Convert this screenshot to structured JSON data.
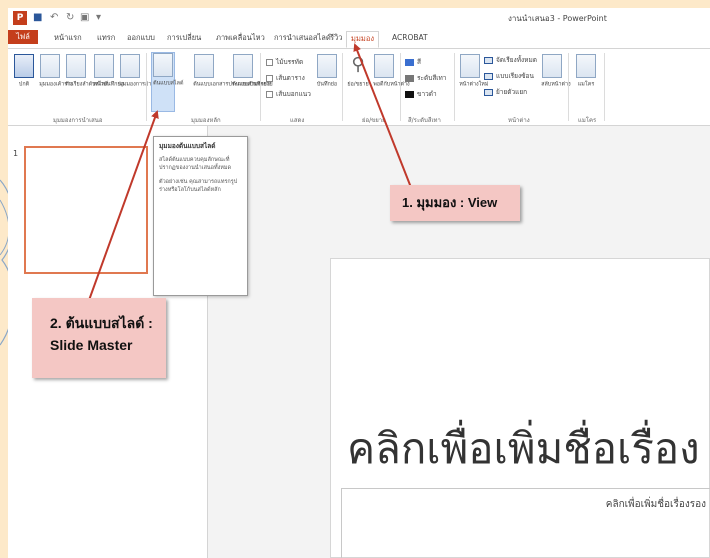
{
  "titlebar": {
    "app_logo": "P",
    "window_title": "งานนำเสนอ3 - PowerPoint",
    "qat_icons": [
      "save-icon",
      "undo-icon",
      "redo-icon",
      "slideshow-icon",
      "more-icon"
    ]
  },
  "tabs": [
    "ไฟล์",
    "หน้าแรก",
    "แทรก",
    "ออกแบบ",
    "การเปลี่ยน",
    "ภาพเคลื่อนไหว",
    "การนำเสนอสไลด์",
    "รีวิว",
    "มุมมอง",
    "ACROBAT"
  ],
  "ribbon": {
    "presentation_views": {
      "buttons": [
        "ปกติ",
        "มุมมองเค้าร่าง",
        "ตัวเรียงลำดับสไลด์",
        "หน้าบันทึกย่อ",
        "มุมมองการอ่าน"
      ],
      "label": "มุมมองการนำเสนอ"
    },
    "master_views": {
      "buttons": [
        "ต้นแบบสไลด์",
        "ต้นแบบเอกสารประกอบคำบรรยาย",
        "ต้นแบบบันทึกย่อ"
      ],
      "label": "มุมมองหลัก"
    },
    "show": {
      "checkboxes": [
        "ไม้บรรทัด",
        "เส้นตาราง",
        "เส้นบอกแนว"
      ],
      "notes_button": "บันทึกย่อ",
      "label": "แสดง"
    },
    "zoom": {
      "buttons": [
        "ย่อ/ขยาย",
        "พอดีกับหน้าต่าง"
      ],
      "label": "ย่อ/ขยาย"
    },
    "color": {
      "items": [
        "สี",
        "ระดับสีเทา",
        "ขาวดำ"
      ],
      "label": "สี/ระดับสีเทา"
    },
    "window": {
      "new_window": "หน้าต่างใหม่",
      "items": [
        "จัดเรียงทั้งหมด",
        "แบบเรียงซ้อน",
        "ย้ายตัวแยก"
      ],
      "switch": "สลับหน้าต่าง",
      "label": "หน้าต่าง"
    },
    "macros": {
      "button": "แมโคร",
      "label": "แมโคร"
    }
  },
  "tooltip": {
    "title": "มุมมองต้นแบบสไลด์",
    "body1": "สไลด์ต้นแบบควบคุมลักษณะที่ปรากฏของงานนำเสนอทั้งหมด",
    "body2": "ตัวอย่างเช่น คุณสามารถแทรกรูปร่างหรือโลโก้บนสไลด์หลัก"
  },
  "slides_pane": {
    "number": "1"
  },
  "slide": {
    "title_placeholder": "คลิกเพื่อเพิ่มชื่อเรื่อง",
    "subtitle_placeholder": "คลิกเพื่อเพิ่มชื่อเรื่องรอง"
  },
  "callouts": {
    "view": "1. มุมมอง : View",
    "master_line1": "2. ต้นแบบสไลด์ :",
    "master_line2": "Slide Master"
  },
  "colors": {
    "accent": "#c43e1c",
    "callout_bg": "#f4c7c4",
    "arrow": "#c0392b",
    "page_bg": "#fde9c9"
  }
}
